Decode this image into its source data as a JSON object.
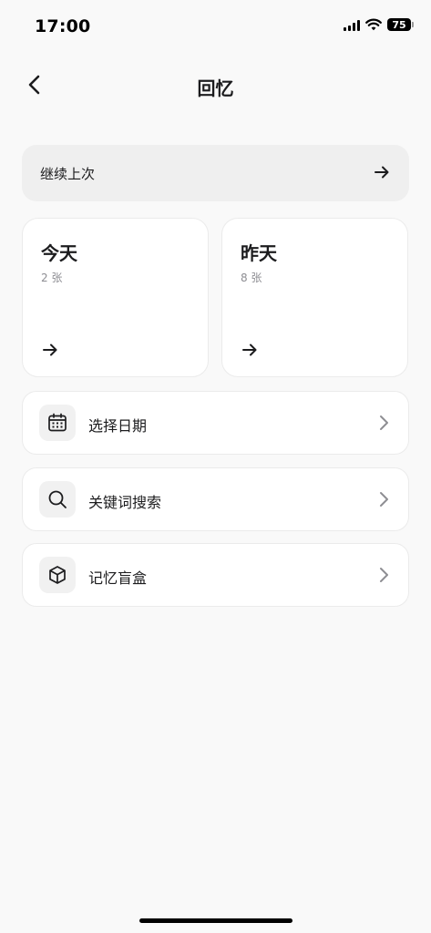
{
  "status_bar": {
    "time": "17:00",
    "battery_level": "75"
  },
  "nav": {
    "title": "回忆",
    "back_icon": "chevron-left-icon"
  },
  "continue": {
    "label": "继续上次",
    "icon": "arrow-right-icon"
  },
  "day_cards": [
    {
      "title": "今天",
      "count": "2 张"
    },
    {
      "title": "昨天",
      "count": "8 张"
    }
  ],
  "list_items": [
    {
      "label": "选择日期",
      "icon": "calendar-icon"
    },
    {
      "label": "关键词搜索",
      "icon": "search-icon"
    },
    {
      "label": "记忆盲盒",
      "icon": "box-icon"
    }
  ],
  "colors": {
    "background": "#f9f9f9",
    "card": "#ffffff",
    "continue_card": "#efefef",
    "icon_box": "#f1f1f1",
    "muted_text": "#8e8e93"
  }
}
